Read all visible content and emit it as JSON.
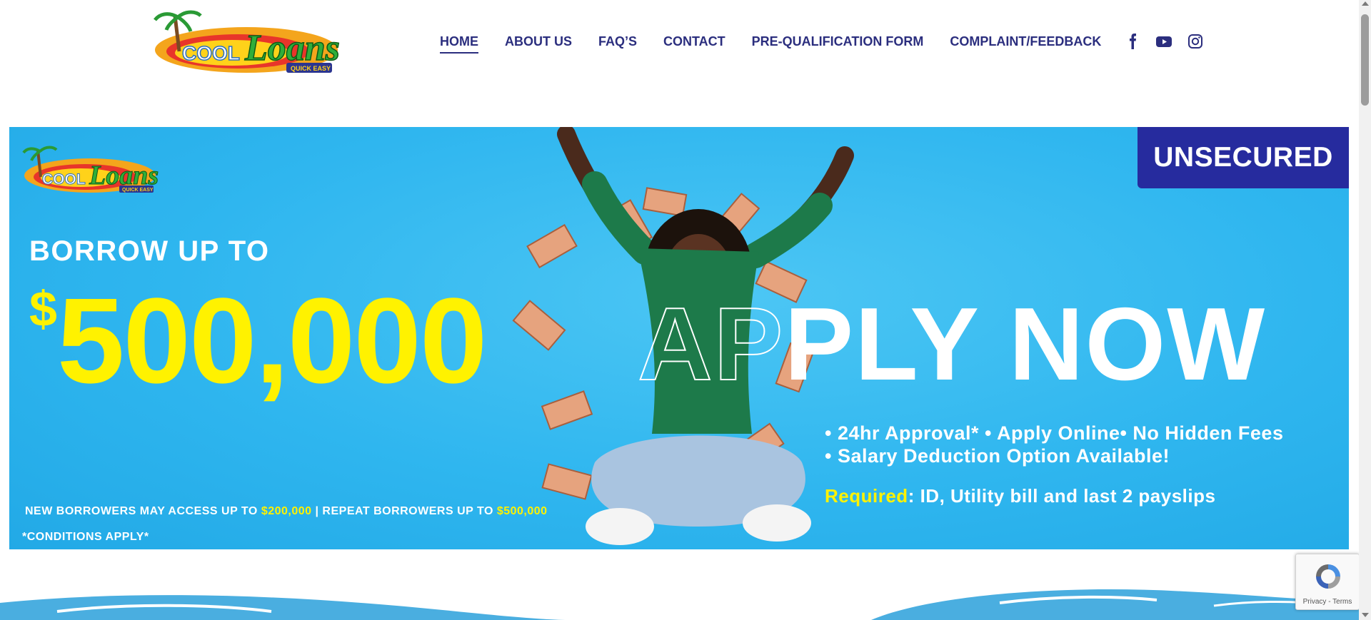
{
  "header": {
    "logo_alt": "Cool Loans Quick Easy",
    "logo_text_cool": "COOL",
    "logo_text_loans": "Loans",
    "logo_tagline": "QUICK EASY",
    "nav": [
      {
        "label": "HOME",
        "active": true
      },
      {
        "label": "ABOUT US"
      },
      {
        "label": "FAQ’S"
      },
      {
        "label": "CONTACT"
      },
      {
        "label": "PRE-QUALIFICATION FORM"
      },
      {
        "label": "COMPLAINT/FEEDBACK"
      }
    ],
    "social": [
      "facebook-icon",
      "youtube-icon",
      "instagram-icon"
    ]
  },
  "banner": {
    "badge": "UNSECURED",
    "borrow": "BORROW UP TO",
    "dollar": "$",
    "amount": "500,000",
    "apply_outline": "AP",
    "apply_rest": "PLY NOW",
    "bullet_line1": "• 24hr Approval* • Apply Online• No Hidden Fees",
    "bullet_line2": "• Salary Deduction Option Available!",
    "required_label": "Required",
    "required_text": ": ID, Utility bill and last 2 payslips",
    "borrowers_a": "NEW BORROWERS MAY ACCESS UP TO ",
    "borrowers_b": "$200,000",
    "borrowers_c": " | REPEAT BORROWERS UP TO ",
    "borrowers_d": "$500,000",
    "conditions": "*CONDITIONS APPLY*"
  },
  "recaptcha": {
    "text": "Privacy - Terms"
  },
  "colors": {
    "nav": "#2b2e7e",
    "banner_bg": "#2fb6ef",
    "badge_bg": "#262b9e",
    "yellow": "#fff200",
    "wave": "#4aaee0"
  }
}
